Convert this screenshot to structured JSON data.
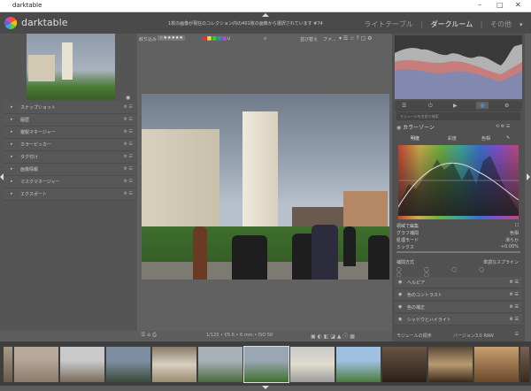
{
  "window": {
    "title": "darktable"
  },
  "header": {
    "brand": "darktable",
    "message": "1枚の画像が現在のコレクション内の401枚の画像から選択されています #74",
    "views": [
      "ライトテーブル",
      "ダークルーム",
      "その他"
    ],
    "active_view": "ダークルーム"
  },
  "left_modules": [
    {
      "label": "スナップショット"
    },
    {
      "label": "履歴"
    },
    {
      "label": "複製マネージャー"
    },
    {
      "label": "カラーピッカー"
    },
    {
      "label": "タグ付け"
    },
    {
      "label": "画像情報"
    },
    {
      "label": "マスクマネージャー"
    },
    {
      "label": "エクスポート"
    }
  ],
  "toolbar": {
    "filter_label": "絞り込み",
    "stars": "☆★★★★★",
    "sort_label": "並び替え",
    "sort_value": "ファ..."
  },
  "bottom_info": "1/125 • f/5.6 • 6 mm • ISO 50",
  "right_panel": {
    "search_placeholder": "モジュールを名前で検索",
    "module_title": "カラーゾーン",
    "tabs": [
      "明度",
      "彩度",
      "色相"
    ],
    "params": [
      {
        "label": "領域で編集",
        "value": ""
      },
      {
        "label": "グラフ補間",
        "value": "色相"
      },
      {
        "label": "処理モード",
        "value": "滑らか"
      },
      {
        "label": "ミックス",
        "value": "+0.00%"
      }
    ],
    "blend_label": "補間方式",
    "blend_value": "単調なスプライン",
    "other_modules": [
      "ヘルピア",
      "色のコントラスト",
      "色の補正",
      "シャドウとハイライト"
    ],
    "footer_left": "モジュールの順序",
    "footer_right": "バージョン3.0 RAW"
  },
  "colors": {
    "accent": "#4a90d9",
    "panel": "#555555",
    "active_tab": "#616161"
  }
}
